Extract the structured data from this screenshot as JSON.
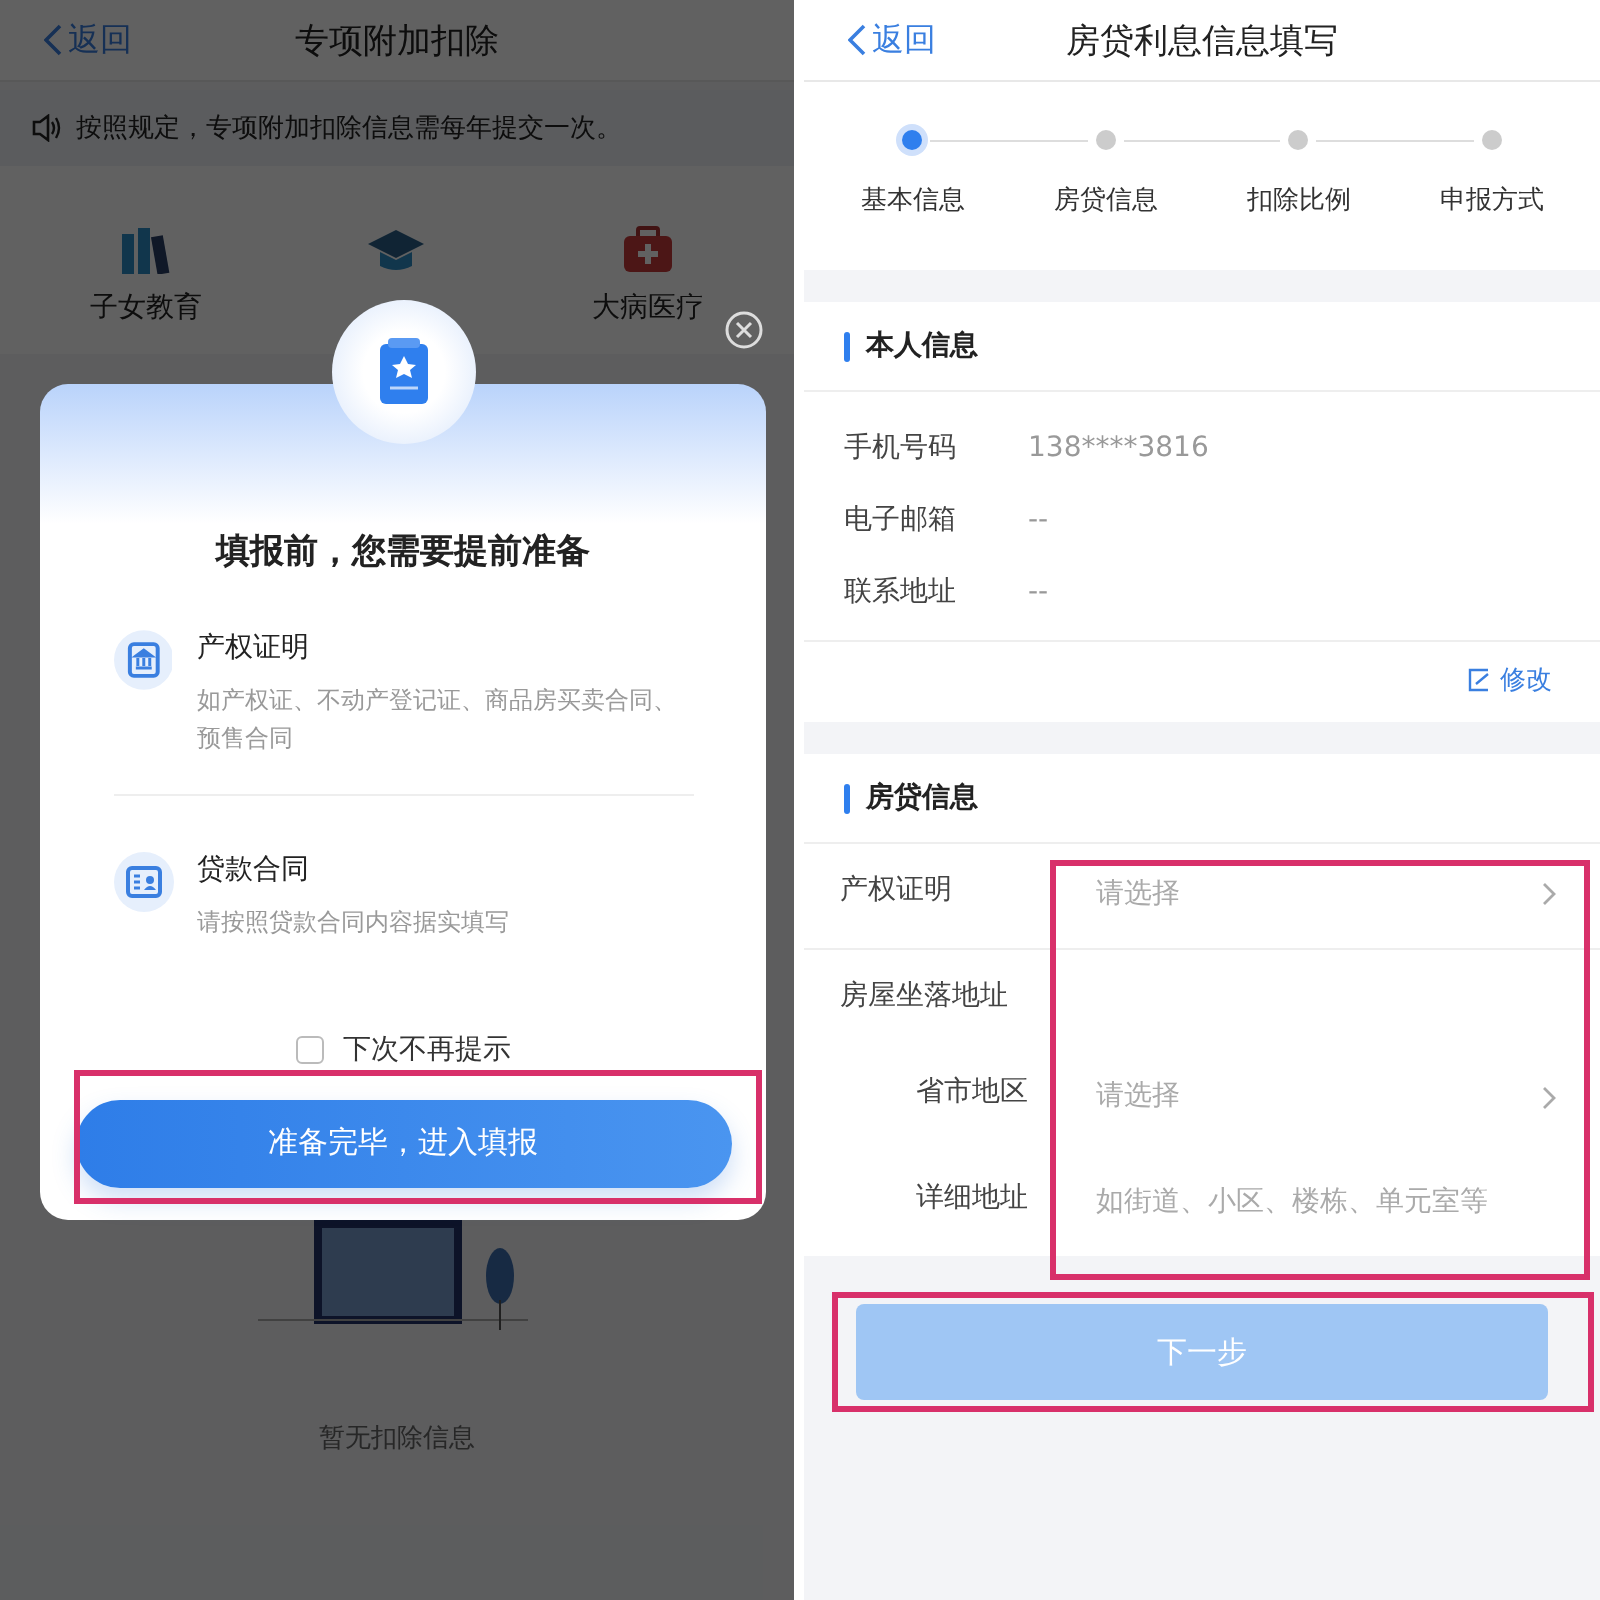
{
  "left": {
    "nav": {
      "back": "返回",
      "title": "专项附加扣除"
    },
    "notice": "按照规定，专项附加扣除信息需每年提交一次。",
    "categories": [
      {
        "kind": "books",
        "label": "子女教育"
      },
      {
        "kind": "cap"
      },
      {
        "kind": "medkit",
        "label": "大病医疗"
      }
    ],
    "empty_text": "暂无扣除信息",
    "dialog": {
      "title": "填报前，您需要提前准备",
      "items": [
        {
          "kind": "deed",
          "title": "产权证明",
          "description": "如产权证、不动产登记证、商品房买卖合同、预售合同"
        },
        {
          "kind": "contract",
          "title": "贷款合同",
          "description": "请按照贷款合同内容据实填写"
        }
      ],
      "dont_remind": {
        "label": "下次不再提示",
        "checked": false
      },
      "confirm_button": "准备完毕，进入填报"
    }
  },
  "right": {
    "nav": {
      "back": "返回",
      "title": "房贷利息信息填写"
    },
    "steps": [
      {
        "label": "基本信息",
        "selected": true
      },
      {
        "label": "房贷信息",
        "selected": false
      },
      {
        "label": "扣除比例",
        "selected": false
      },
      {
        "label": "申报方式",
        "selected": false
      }
    ],
    "personal": {
      "title": "本人信息",
      "rows": [
        {
          "label": "手机号码",
          "value": "138****3816"
        },
        {
          "label": "电子邮箱",
          "value": "--"
        },
        {
          "label": "联系地址",
          "value": "--"
        }
      ],
      "edit_link": "修改"
    },
    "loan": {
      "title": "房贷信息",
      "fields": [
        {
          "kind": "select",
          "label": "产权证明",
          "placeholder": "请选择"
        },
        {
          "kind": "group",
          "label": "房屋坐落地址",
          "children": [
            {
              "kind": "select",
              "label": "省市地区",
              "placeholder": "请选择"
            },
            {
              "kind": "text",
              "label": "详细地址",
              "placeholder": "如街道、小区、楼栋、单元室等"
            }
          ]
        }
      ]
    },
    "next_button": {
      "label": "下一步",
      "disabled": true
    }
  }
}
